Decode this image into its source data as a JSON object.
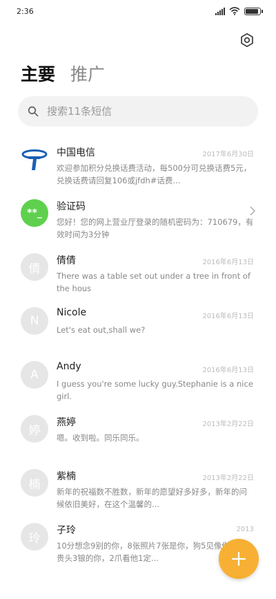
{
  "status_bar": {
    "time": "2:36",
    "battery_level": 0.9
  },
  "header": {
    "tabs": [
      {
        "label": "主要",
        "active": true
      },
      {
        "label": "推广",
        "active": false
      }
    ]
  },
  "search": {
    "placeholder": "搜索11条短信"
  },
  "icons": {
    "settings": "gear-icon",
    "search": "search-icon",
    "compose": "plus-icon",
    "chevron": "chevron-right-icon"
  },
  "conversations": [
    {
      "avatar": "",
      "name": "中国电信",
      "date": "2017年6月30日",
      "preview": "欢迎参加积分兑换话费活动，每500分可兑换话费5元，兑换话费请回复106或jfdh#话费..."
    },
    {
      "avatar": "**_",
      "name": "验证码",
      "date": "",
      "preview": "您好！您的网上营业厅登录的随机密码为：710679，有效时间为3分钟"
    },
    {
      "avatar": "倩",
      "name": "倩倩",
      "date": "2016年6月13日",
      "preview": "There was a table set out under a tree in front of the hous"
    },
    {
      "avatar": "N",
      "name": "Nicole",
      "date": "2016年6月13日",
      "preview": "Let's eat out,shall we?"
    },
    {
      "avatar": "A",
      "name": "Andy",
      "date": "2016年6月13日",
      "preview": "I guess you're some lucky guy.Stephanie is a nice girl."
    },
    {
      "avatar": "婷",
      "name": "燕婷",
      "date": "2013年2月22日",
      "preview": "嗯。收到啦。同乐同乐。"
    },
    {
      "avatar": "楠",
      "name": "紫楠",
      "date": "2013年2月22日",
      "preview": "新年的祝福数不胜数，新年的愿望好多好多，新年的问候依旧美好，在这个温馨的..."
    },
    {
      "avatar": "玲",
      "name": "子玲",
      "date": "2013",
      "preview": "10分想念9别的你，8张照片7张是你，狗5见像你，4锒贵头3锒的你，2爪看他1定..."
    }
  ],
  "colors": {
    "accent": "#f7b033",
    "verify_avatar": "#5fd04e",
    "telecom_blue": "#1a5fb4"
  }
}
